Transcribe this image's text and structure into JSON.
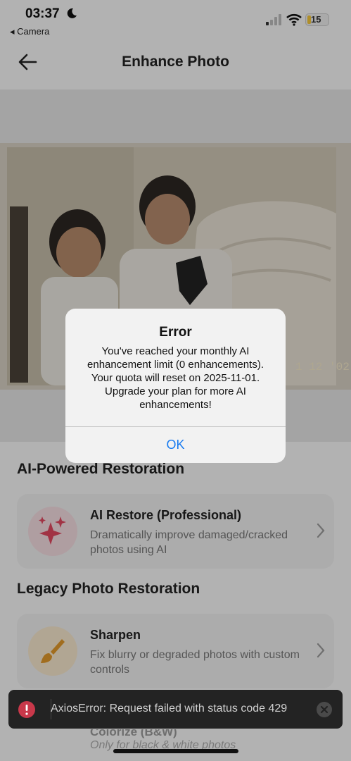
{
  "status_bar": {
    "time": "03:37",
    "back_app": "◂ Camera",
    "battery_level": "15"
  },
  "header": {
    "title": "Enhance Photo"
  },
  "photo": {
    "date_stamp": "1 12 '02"
  },
  "sections": [
    {
      "title": "AI-Powered Restoration",
      "cards": [
        {
          "title": "AI Restore (Professional)",
          "description": "Dramatically improve damaged/cracked photos using AI",
          "icon": "sparkles-icon"
        }
      ]
    },
    {
      "title": "Legacy Photo Restoration",
      "cards": [
        {
          "title": "Sharpen",
          "description": "Fix blurry or degraded photos with custom controls",
          "icon": "brush-icon"
        },
        {
          "title": "Colorize (B&W)",
          "description": "Only for black & white photos",
          "icon": "palette-icon"
        }
      ]
    }
  ],
  "dialog": {
    "title": "Error",
    "message": "You've reached your monthly AI enhancement limit (0 enhancements). Your quota will reset on 2025-11-01. Upgrade your plan for more AI enhancements!",
    "ok_label": "OK"
  },
  "toast": {
    "message": "AxiosError: Request failed with status code 429"
  },
  "colors": {
    "accent": "#1a7cf0",
    "ai_icon": "#e0475f",
    "sharpen_icon": "#e0982a",
    "toast_bg": "#232323"
  }
}
